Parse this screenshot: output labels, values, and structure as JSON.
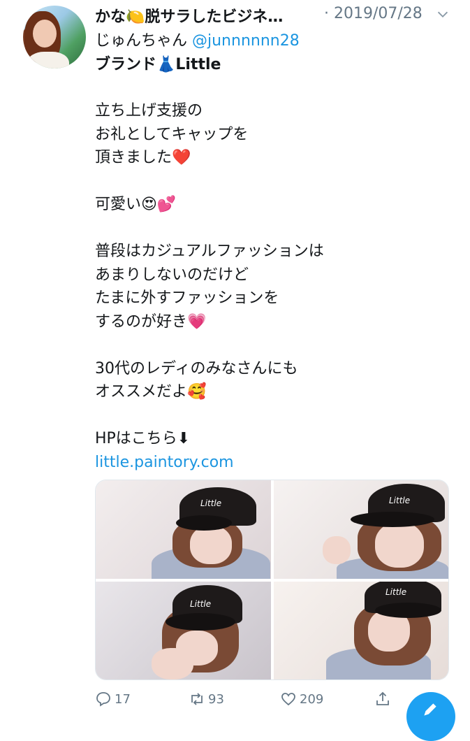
{
  "tweet": {
    "display_name": "かな🍋脱サラしたビジネ…",
    "timestamp": "· 2019/07/28",
    "subline_prefix": "じゅんちゃん ",
    "handle": "@junnnnnn28",
    "brand_line": "ブランド👗Little",
    "body_lines": [
      "立ち上げ支援の",
      "お礼としてキャップを",
      "頂きました❤️",
      "",
      "可愛い😍💕",
      "",
      "普段はカジュアルファッションは",
      "あまりしないのだけど",
      "たまに外すファッションを",
      "するのが好き💗",
      "",
      "30代のレディのみなさんにも",
      "オススメだよ🥰",
      "",
      "HPはこちら⬇"
    ],
    "link": "little.paintory.com",
    "photo_cap_text": [
      "Little",
      "Little",
      "Little",
      "Little"
    ]
  },
  "actions": {
    "reply_count": "17",
    "retweet_count": "93",
    "like_count": "209"
  },
  "colors": {
    "link_blue": "#1b95e0",
    "muted_gray": "#657786",
    "fab_blue": "#1da1f2"
  },
  "icons": [
    "avatar",
    "chevron-down-icon",
    "reply-icon",
    "retweet-icon",
    "like-icon",
    "share-icon",
    "compose-icon"
  ]
}
